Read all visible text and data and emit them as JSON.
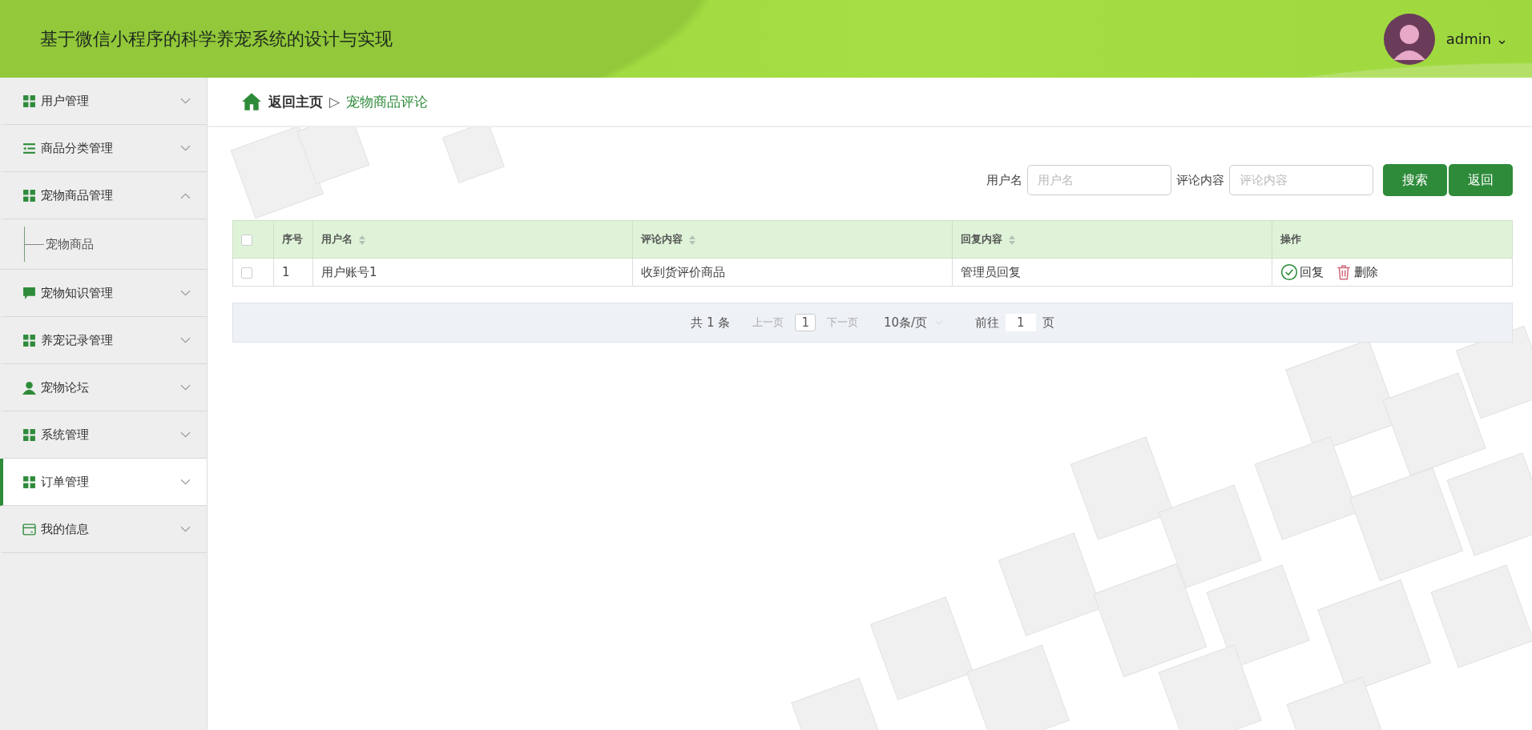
{
  "header": {
    "title": "基于微信小程序的科学养宠系统的设计与实现",
    "user": "admin",
    "caret": "⌄"
  },
  "sidebar": {
    "items": [
      {
        "label": "用户管理",
        "kind": "grid",
        "expanded": false,
        "selected": false
      },
      {
        "label": "商品分类管理",
        "kind": "list",
        "expanded": false,
        "selected": false
      },
      {
        "label": "宠物商品管理",
        "kind": "grid",
        "expanded": true,
        "selected": false,
        "children": [
          {
            "label": "宠物商品"
          }
        ]
      },
      {
        "label": "宠物知识管理",
        "kind": "chat",
        "expanded": false,
        "selected": false
      },
      {
        "label": "养宠记录管理",
        "kind": "grid",
        "expanded": false,
        "selected": false
      },
      {
        "label": "宠物论坛",
        "kind": "person",
        "expanded": false,
        "selected": false
      },
      {
        "label": "系统管理",
        "kind": "grid",
        "expanded": false,
        "selected": false
      },
      {
        "label": "订单管理",
        "kind": "grid",
        "expanded": false,
        "selected": true
      },
      {
        "label": "我的信息",
        "kind": "card",
        "expanded": false,
        "selected": false
      }
    ]
  },
  "breadcrumb": {
    "home": "返回主页",
    "separator": "▷",
    "current": "宠物商品评论"
  },
  "search": {
    "fields": [
      {
        "label": "用户名",
        "placeholder": "用户名"
      },
      {
        "label": "评论内容",
        "placeholder": "评论内容"
      }
    ],
    "buttons": [
      "搜索",
      "返回"
    ]
  },
  "table": {
    "header_checked": false,
    "columns": [
      {
        "label": "序号",
        "sortable": false
      },
      {
        "label": "用户名",
        "sortable": true
      },
      {
        "label": "评论内容",
        "sortable": true
      },
      {
        "label": "回复内容",
        "sortable": true
      },
      {
        "label": "操作",
        "sortable": false
      }
    ],
    "rows": [
      {
        "checked": false,
        "cells": [
          "1",
          "用户账号1",
          "收到货评价商品",
          "管理员回复"
        ],
        "actions": [
          {
            "kind": "reply",
            "label": "回复"
          },
          {
            "kind": "delete",
            "label": "删除"
          }
        ]
      }
    ]
  },
  "pagination": {
    "total": "共 1 条",
    "prev": "上一页",
    "page": "1",
    "next": "下一页",
    "page_size": "10条/页",
    "goto": "前往",
    "goto_value": "1",
    "page_unit": "页"
  }
}
